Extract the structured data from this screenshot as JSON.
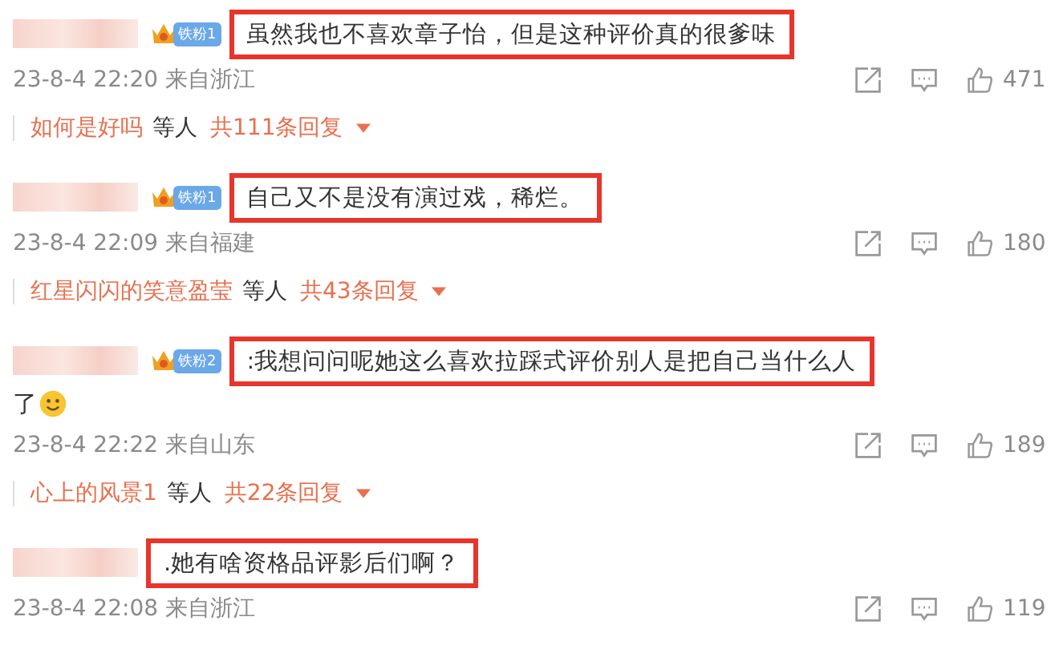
{
  "comments": [
    {
      "badge": "铁粉1",
      "text": "虽然我也不喜欢章子怡，但是这种评价真的很爹味",
      "time": "23-8-4 22:20 来自浙江",
      "likes": "471",
      "reply": {
        "name": "如何是好吗",
        "suffix": "等人",
        "count": "共111条回复"
      }
    },
    {
      "badge": "铁粉1",
      "text": "自己又不是没有演过戏，稀烂。",
      "time": "23-8-4 22:09 来自福建",
      "likes": "180",
      "reply": {
        "name": "红星闪闪的笑意盈莹",
        "suffix": "等人",
        "count": "共43条回复"
      }
    },
    {
      "badge": "铁粉2",
      "text": ":我想问问呢她这么喜欢拉踩式评价别人是把自己当什么人",
      "continuation": "了",
      "emoji": true,
      "time": "23-8-4 22:22 来自山东",
      "likes": "189",
      "reply": {
        "name": "心上的风景1",
        "suffix": "等人",
        "count": "共22条回复"
      }
    },
    {
      "text": ".她有啥资格品评影后们啊？",
      "time": "23-8-4 22:08 来自浙江",
      "likes": "119"
    }
  ]
}
